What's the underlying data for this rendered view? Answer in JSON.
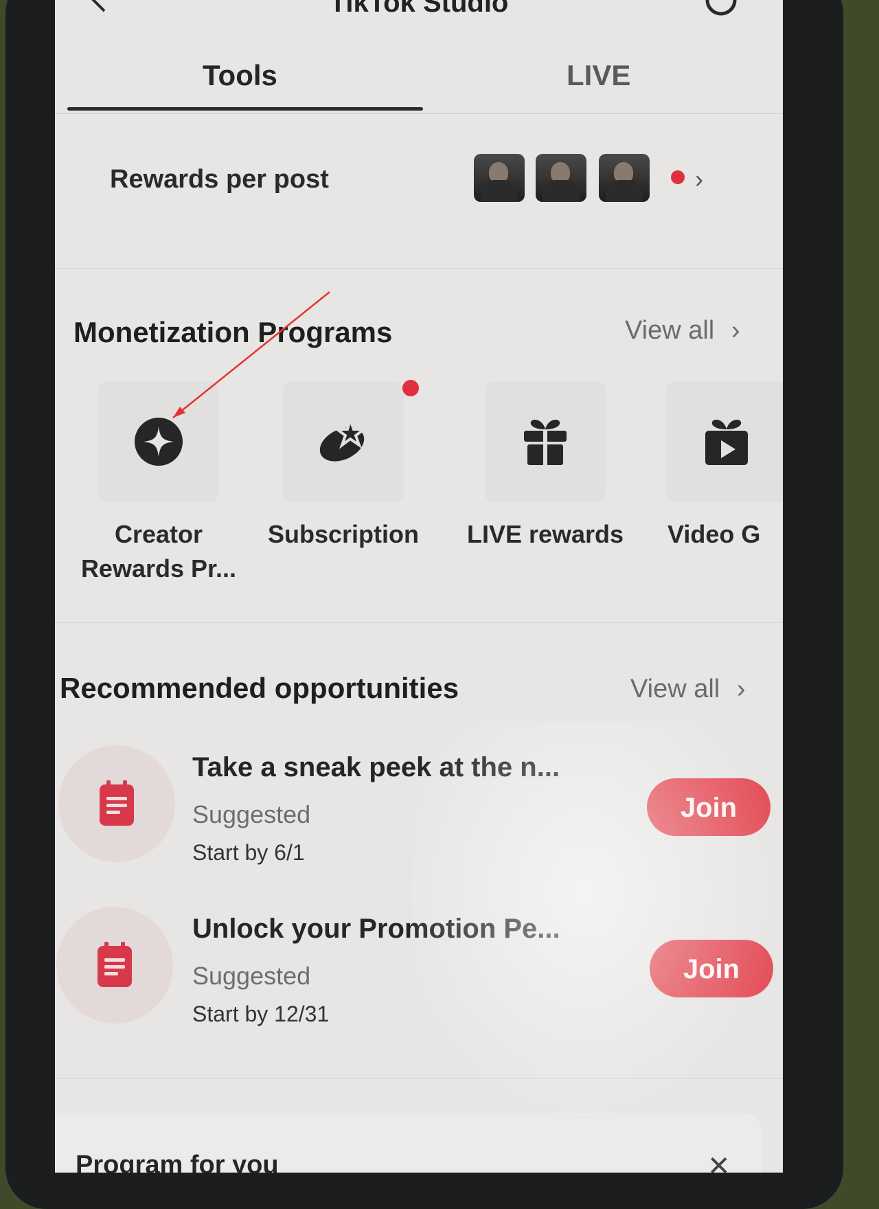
{
  "app_title": "TikTok Studio",
  "tabs": [
    {
      "label": "Tools",
      "active": true
    },
    {
      "label": "LIVE",
      "active": false
    }
  ],
  "rewards_row": {
    "label": "Rewards per post"
  },
  "monetization": {
    "title": "Monetization Programs",
    "view_all": "View all",
    "items": [
      {
        "line1": "Creator",
        "line2": "Rewards Pr...",
        "icon": "sparkle-star-icon"
      },
      {
        "line1": "Subscription",
        "line2": "",
        "icon": "planet-star-icon"
      },
      {
        "line1": "LIVE rewards",
        "line2": "",
        "icon": "gift-icon"
      },
      {
        "line1": "Video G",
        "line2": "",
        "icon": "video-gift-icon"
      }
    ]
  },
  "recommended": {
    "title": "Recommended opportunities",
    "view_all": "View all",
    "items": [
      {
        "title": "Take a sneak peek at the n...",
        "status": "Suggested",
        "date": "Start by 6/1",
        "button": "Join",
        "icon": "clipboard-icon"
      },
      {
        "title": "Unlock your Promotion Pe...",
        "status": "Suggested",
        "date": "Start by 12/31",
        "button": "Join",
        "icon": "clipboard-icon"
      }
    ]
  },
  "program_for_you": {
    "title": "Program for you"
  },
  "colors": {
    "accent": "#e4535d",
    "notification": "#e0303f",
    "background": "#e7e6e4"
  }
}
